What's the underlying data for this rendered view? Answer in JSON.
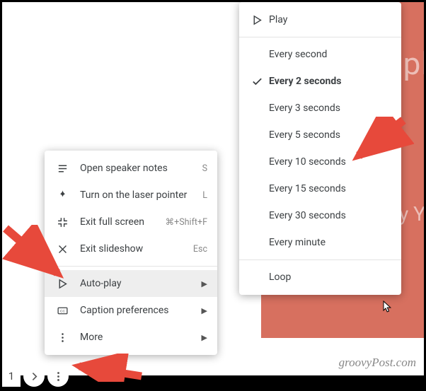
{
  "slide": {
    "line1": "Simpl",
    "line2": "By Y"
  },
  "watermark": "groovyPost.com",
  "toolbar": {
    "page_num": "1"
  },
  "menu": {
    "items": [
      {
        "label": "Open speaker notes",
        "shortcut": "S"
      },
      {
        "label": "Turn on the laser pointer",
        "shortcut": "L"
      },
      {
        "label": "Exit full screen",
        "shortcut": "⌘+Shift+F"
      },
      {
        "label": "Exit slideshow",
        "shortcut": "Esc"
      },
      {
        "label": "Auto-play"
      },
      {
        "label": "Caption preferences"
      },
      {
        "label": "More"
      }
    ]
  },
  "submenu": {
    "play": "Play",
    "loop": "Loop",
    "intervals": [
      "Every second",
      "Every 2 seconds",
      "Every 3 seconds",
      "Every 5 seconds",
      "Every 10 seconds",
      "Every 15 seconds",
      "Every 30 seconds",
      "Every minute"
    ]
  }
}
